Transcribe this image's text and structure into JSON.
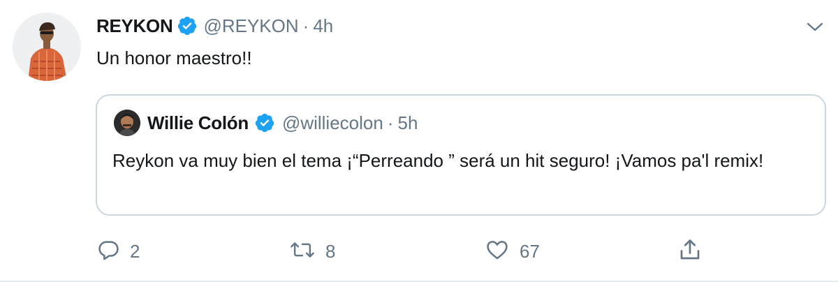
{
  "tweet": {
    "author_name": "REYKON",
    "author_handle": "@REYKON",
    "separator": "·",
    "time": "4h",
    "text": "Un honor maestro!!",
    "verified": true
  },
  "quoted": {
    "author_name": "Willie Colón",
    "author_handle": "@williecolon",
    "separator": "·",
    "time": "5h",
    "text": "Reykon  va muy bien el tema  ¡“Perreando ” será un hit seguro! ¡Vamos pa'l remix!",
    "verified": true
  },
  "actions": {
    "reply_count": "2",
    "retweet_count": "8",
    "like_count": "67"
  },
  "colors": {
    "verified_blue": "#1da1f2",
    "secondary_text": "#657786",
    "border": "#ccd6dd"
  },
  "icons": [
    "verified-badge-icon",
    "chevron-down-icon",
    "reply-icon",
    "retweet-icon",
    "like-icon",
    "share-icon"
  ]
}
